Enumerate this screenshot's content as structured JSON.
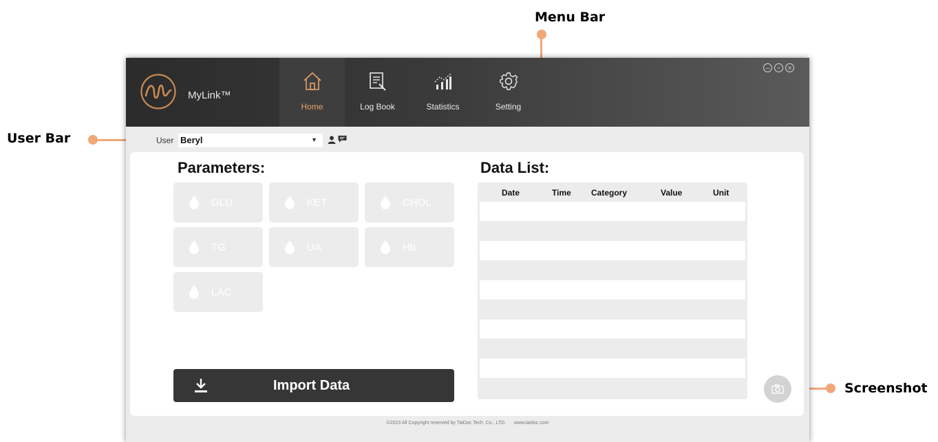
{
  "annotations": {
    "menu_bar": "Menu Bar",
    "user_bar": "User Bar",
    "screenshot": "Screenshot",
    "color": "#f0a878"
  },
  "app": {
    "brand": "MyLink™",
    "accent_color": "#e8a26c"
  },
  "menu": {
    "items": [
      {
        "label": "Home",
        "icon": "home-icon",
        "active": true
      },
      {
        "label": "Log Book",
        "icon": "logbook-icon",
        "active": false
      },
      {
        "label": "Statistics",
        "icon": "statistics-icon",
        "active": false
      },
      {
        "label": "Setting",
        "icon": "gear-icon",
        "active": false
      }
    ]
  },
  "window_controls": {
    "icons": [
      "minimize-icon",
      "restore-icon",
      "close-icon"
    ]
  },
  "user_bar": {
    "label": "User",
    "selected_user": "Beryl",
    "icons": [
      "user-icon",
      "message-icon"
    ]
  },
  "parameters": {
    "title": "Parameters:",
    "items": [
      "GLU",
      "KET",
      "CHOL",
      "TG",
      "UA",
      "Hb",
      "LAC"
    ]
  },
  "data_list": {
    "title": "Data List:",
    "columns": [
      "Date",
      "Time",
      "Category",
      "Value",
      "Unit"
    ],
    "rows": []
  },
  "import": {
    "label": "Import Data"
  },
  "footer": {
    "copyright": "©2023 All Copyright reserved by TaiDoc Tech. Co., LTD.",
    "website": "www.taidoc.com"
  }
}
